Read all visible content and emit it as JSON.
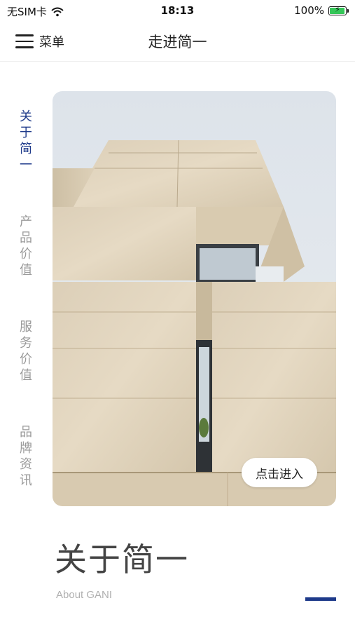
{
  "status_bar": {
    "carrier": "无SIM卡",
    "time": "18:13",
    "battery": "100%",
    "battery_level": 1.0
  },
  "nav": {
    "menu_label": "菜单",
    "title": "走进简一"
  },
  "side_nav": {
    "items": [
      {
        "label": "关于简一",
        "active": true
      },
      {
        "label": "产品价值",
        "active": false
      },
      {
        "label": "服务价值",
        "active": false
      },
      {
        "label": "品牌资讯",
        "active": false
      }
    ]
  },
  "hero": {
    "button_label": "点击进入"
  },
  "section": {
    "title": "关于简一",
    "subtitle": "About GANI"
  },
  "colors": {
    "accent": "#1e3a8a",
    "inactive_text": "#9a9a9a"
  }
}
